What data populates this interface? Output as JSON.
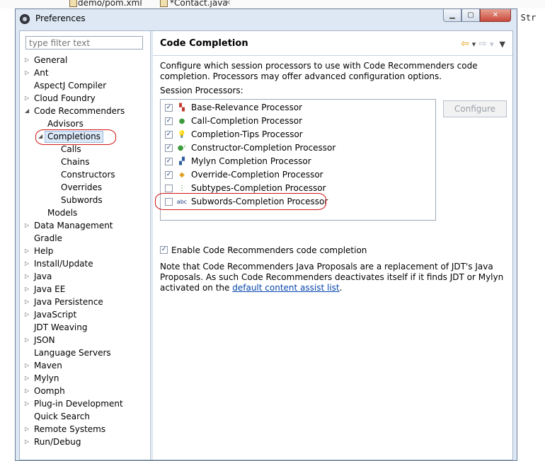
{
  "background": {
    "tabs": [
      {
        "label": "demo/pom.xml"
      },
      {
        "label": "*Contact.java",
        "close": "✕"
      }
    ],
    "code_snippet": "l, Str"
  },
  "window": {
    "title": "Preferences",
    "controls": {
      "minimize": "▁",
      "maximize": "▢",
      "close": "✕"
    }
  },
  "filter": {
    "placeholder": "type filter text"
  },
  "tree": {
    "items": [
      {
        "label": "General",
        "expander": "▷"
      },
      {
        "label": "Ant",
        "expander": "▷"
      },
      {
        "label": "AspectJ Compiler",
        "expander": ""
      },
      {
        "label": "Cloud Foundry",
        "expander": "▷"
      },
      {
        "label": "Code Recommenders",
        "expander": "◢"
      },
      {
        "label": "Advisors",
        "expander": ""
      },
      {
        "label": "Completions",
        "expander": "◢",
        "selected": true
      },
      {
        "label": "Calls",
        "expander": ""
      },
      {
        "label": "Chains",
        "expander": ""
      },
      {
        "label": "Constructors",
        "expander": ""
      },
      {
        "label": "Overrides",
        "expander": ""
      },
      {
        "label": "Subwords",
        "expander": ""
      },
      {
        "label": "Models",
        "expander": ""
      },
      {
        "label": "Data Management",
        "expander": "▷"
      },
      {
        "label": "Gradle",
        "expander": ""
      },
      {
        "label": "Help",
        "expander": "▷"
      },
      {
        "label": "Install/Update",
        "expander": "▷"
      },
      {
        "label": "Java",
        "expander": "▷"
      },
      {
        "label": "Java EE",
        "expander": "▷"
      },
      {
        "label": "Java Persistence",
        "expander": "▷"
      },
      {
        "label": "JavaScript",
        "expander": "▷"
      },
      {
        "label": "JDT Weaving",
        "expander": ""
      },
      {
        "label": "JSON",
        "expander": "▷"
      },
      {
        "label": "Language Servers",
        "expander": ""
      },
      {
        "label": "Maven",
        "expander": "▷"
      },
      {
        "label": "Mylyn",
        "expander": "▷"
      },
      {
        "label": "Oomph",
        "expander": "▷"
      },
      {
        "label": "Plug-in Development",
        "expander": "▷"
      },
      {
        "label": "Quick Search",
        "expander": ""
      },
      {
        "label": "Remote Systems",
        "expander": "▷"
      },
      {
        "label": "Run/Debug",
        "expander": "▷"
      }
    ]
  },
  "page": {
    "title": "Code Completion",
    "nav": {
      "back": "⇦",
      "forward": "⇨",
      "dropdown": "▾",
      "menu": "▼"
    },
    "description": "Configure which session processors to use with Code Recommenders code completion. Processors may offer advanced configuration options.",
    "session_processors_label": "Session Processors:",
    "processors": [
      {
        "label": "Base-Relevance Processor",
        "checked": true,
        "icon": "base-relevance-icon",
        "glyph": "▚",
        "color": "#c0392b"
      },
      {
        "label": "Call-Completion Processor",
        "checked": true,
        "icon": "green-dot-icon",
        "glyph": "●",
        "color": "#3d9a3d"
      },
      {
        "label": "Completion-Tips Processor",
        "checked": true,
        "icon": "lightbulb-icon",
        "glyph": "💡",
        "color": "#e8c020"
      },
      {
        "label": "Constructor-Completion Processor",
        "checked": true,
        "icon": "constructor-icon",
        "glyph": "●ᶜ",
        "color": "#3d9a3d"
      },
      {
        "label": "Mylyn Completion Processor",
        "checked": true,
        "icon": "mylyn-icon",
        "glyph": "▞",
        "color": "#2c5aa0"
      },
      {
        "label": "Override-Completion Processor",
        "checked": true,
        "icon": "override-icon",
        "glyph": "◆",
        "color": "#e0a020"
      },
      {
        "label": "Subtypes-Completion Processor",
        "checked": false,
        "icon": "subtypes-icon",
        "glyph": "⋮",
        "color": "#3d9a3d"
      },
      {
        "label": "Subwords-Completion Processor",
        "checked": false,
        "icon": "abc-icon",
        "glyph": "abc",
        "color": "#1c3c78"
      }
    ],
    "configure_button": "Configure",
    "enable_label": "Enable Code Recommenders code completion",
    "enable_checked": true,
    "note_text": "Note that Code Recommenders Java Proposals are a replacement of JDT's Java Proposals. As such Code Recommenders deactivates itself if it finds JDT or Mylyn activated on the ",
    "note_link": "default content assist list",
    "note_end": "."
  },
  "colors": {
    "highlight_oval": "#d01818",
    "selection": "#dbe8f8",
    "link": "#0645ad"
  }
}
